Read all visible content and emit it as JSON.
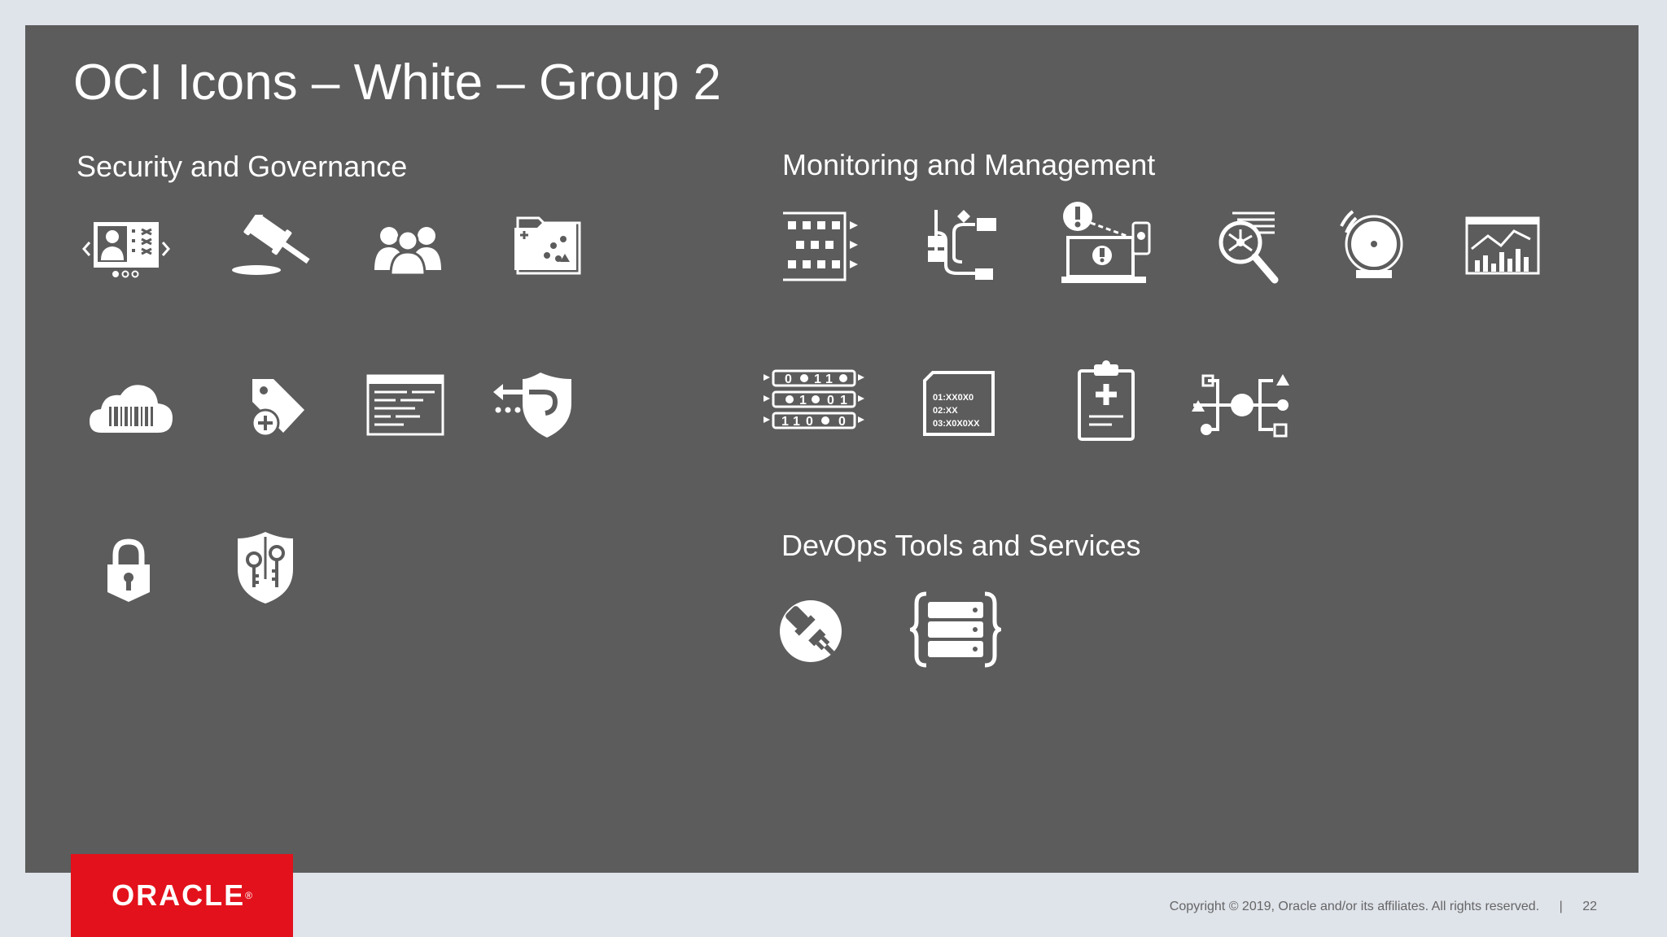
{
  "slide": {
    "title": "OCI Icons – White – Group 2",
    "page_number": "22",
    "copyright": "Copyright © 2019, Oracle and/or its affiliates. All rights reserved.",
    "separator": "|",
    "logo_text": "ORACLE",
    "logo_mark": "®"
  },
  "sections": {
    "security": {
      "heading": "Security and Governance",
      "icons": [
        "identity-console-icon",
        "gavel-icon",
        "user-group-icon",
        "compartment-folder-icon",
        "cloud-barcode-icon",
        "tag-add-icon",
        "audit-log-icon",
        "shield-redirect-icon",
        "padlock-icon",
        "key-vault-shield-icon"
      ]
    },
    "monitoring": {
      "heading": "Monitoring and Management",
      "icons": [
        "event-grid-icon",
        "workflow-icon",
        "notification-alert-icon",
        "search-analytics-icon",
        "alarm-bell-icon",
        "metrics-chart-icon",
        "streaming-data-icon",
        "log-file-icon",
        "health-check-clipboard-icon",
        "service-connector-icon"
      ]
    },
    "devops": {
      "heading": "DevOps Tools and Services",
      "icons": [
        "plugin-connector-icon",
        "resource-manager-icon"
      ]
    }
  },
  "colors": {
    "panel": "#5c5c5c",
    "page": "#dfe3ea",
    "oracle_red": "#e3111b",
    "icon": "#ffffff"
  }
}
